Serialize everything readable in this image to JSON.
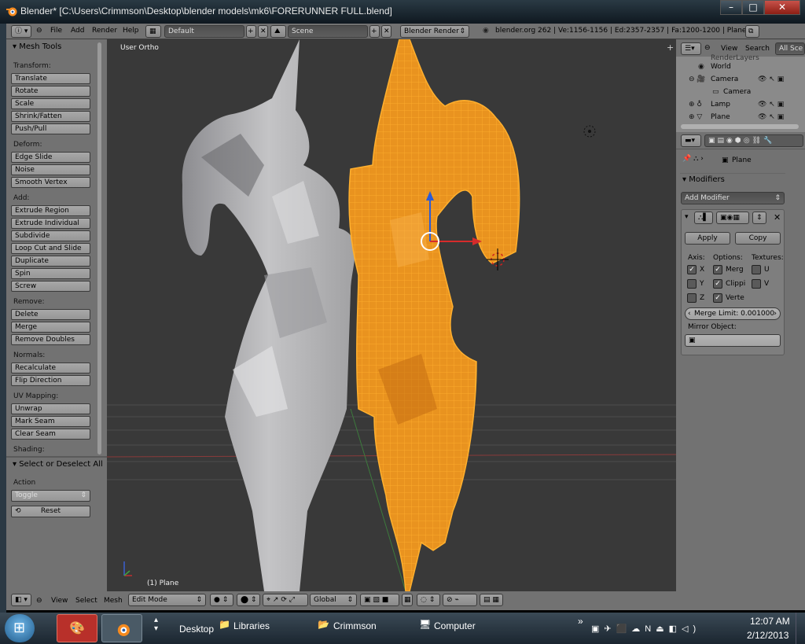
{
  "window": {
    "title": "Blender* [C:\\Users\\Crimmson\\Desktop\\blender models\\mk6\\FORERUNNER FULL.blend]",
    "min": "–",
    "max": "□",
    "close": "✕"
  },
  "infobar": {
    "menus": [
      "File",
      "Add",
      "Render",
      "Help"
    ],
    "layout": "Default",
    "scene": "Scene",
    "engine": "Blender Render",
    "stats": "blender.org 262 | Ve:1156-1156 | Ed:2357-2357 | Fa:1200-1200 | Plane"
  },
  "toolshelf": {
    "title": "Mesh Tools",
    "groups": [
      {
        "label": "Transform:",
        "items": [
          "Translate",
          "Rotate",
          "Scale",
          "Shrink/Fatten",
          "Push/Pull"
        ]
      },
      {
        "label": "Deform:",
        "items": [
          "Edge Slide",
          "Noise",
          "Smooth Vertex"
        ]
      },
      {
        "label": "Add:",
        "items": [
          "Extrude Region",
          "Extrude Individual",
          "Subdivide",
          "Loop Cut and Slide",
          "Duplicate",
          "Spin",
          "Screw"
        ]
      },
      {
        "label": "Remove:",
        "items": [
          "Delete",
          "Merge",
          "Remove Doubles"
        ]
      },
      {
        "label": "Normals:",
        "items": [
          "Recalculate",
          "Flip Direction"
        ]
      },
      {
        "label": "UV Mapping:",
        "items": [
          "Unwrap",
          "Mark Seam",
          "Clear Seam"
        ]
      },
      {
        "label": "Shading:",
        "items": []
      }
    ],
    "op_title": "Select or Deselect All",
    "action_label": "Action",
    "action_value": "Toggle",
    "reset": "Reset"
  },
  "viewport": {
    "view_label": "User Ortho",
    "object_label": "(1) Plane"
  },
  "vheader": {
    "menus": [
      "View",
      "Select",
      "Mesh"
    ],
    "mode": "Edit Mode",
    "orientation": "Global"
  },
  "outliner": {
    "menus": [
      "View",
      "Search"
    ],
    "filter": "All Sce",
    "items": [
      "World",
      "Camera",
      "Camera",
      "Lamp",
      "Plane"
    ],
    "partial_top": "RenderLayers"
  },
  "props": {
    "breadcrumb": "Plane",
    "modifiers_title": "Modifiers",
    "add_modifier": "Add Modifier",
    "apply": "Apply",
    "copy": "Copy",
    "axis_label": "Axis:",
    "options_label": "Options:",
    "textures_label": "Textures:",
    "axes": [
      "X",
      "Y",
      "Z"
    ],
    "options": [
      "Merg",
      "Clippi",
      "Verte"
    ],
    "textures": [
      "U",
      "V"
    ],
    "merge_limit": "Merge Limit: 0.001000",
    "mirror_object": "Mirror Object:"
  },
  "taskbar": {
    "desktop": "Desktop",
    "libraries": "Libraries",
    "crimmson": "Crimmson",
    "computer": "Computer",
    "time": "12:07 AM",
    "date": "2/12/2013"
  },
  "colors": {
    "panel": "#727272",
    "viewport": "#393939",
    "selected": "#f29a1d",
    "mesh": "#a9a9ac"
  }
}
